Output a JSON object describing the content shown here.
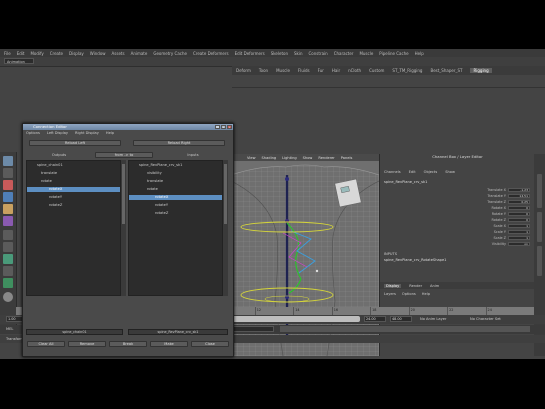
{
  "menubar": [
    "File",
    "Edit",
    "Modify",
    "Create",
    "Display",
    "Window",
    "Assets",
    "Animate",
    "Geometry Cache",
    "Create Deformers",
    "Edit Deformers",
    "Skeleton",
    "Skin",
    "Constrain",
    "Character",
    "Muscle",
    "Pipeline Cache",
    "Help"
  ],
  "mode": "Animation",
  "shelf_tabs": [
    {
      "label": "Deform",
      "active": false
    },
    {
      "label": "Toon",
      "active": false
    },
    {
      "label": "Muscle",
      "active": false
    },
    {
      "label": "Fluids",
      "active": false
    },
    {
      "label": "Fur",
      "active": false
    },
    {
      "label": "Hair",
      "active": false
    },
    {
      "label": "nCloth",
      "active": false
    },
    {
      "label": "Custom",
      "active": false
    },
    {
      "label": "ST_TM_Rigging",
      "active": false
    },
    {
      "label": "Best_Shaper_ST",
      "active": false
    },
    {
      "label": "Rigging",
      "active": true
    }
  ],
  "connection_editor": {
    "title": "Connection Editor",
    "menu": [
      "Options",
      "Left Display",
      "Right Display",
      "Help"
    ],
    "reload_left": "Reload Left",
    "reload_right": "Reload Right",
    "outputs_label": "Outputs",
    "from_to_label": "from -> to",
    "inputs_label": "Inputs",
    "left_items": [
      {
        "label": "spine_chain01",
        "indent": 10,
        "sel": false
      },
      {
        "label": "translate",
        "indent": 14,
        "sel": false
      },
      {
        "label": "rotate",
        "indent": 14,
        "sel": false
      },
      {
        "label": "rotateX",
        "indent": 22,
        "sel": true
      },
      {
        "label": "rotateY",
        "indent": 22,
        "sel": false
      },
      {
        "label": "rotateZ",
        "indent": 22,
        "sel": false
      }
    ],
    "right_items": [
      {
        "label": "spine_RevPlane_crv_sk1",
        "indent": 10,
        "sel": false
      },
      {
        "label": "visibility",
        "indent": 18,
        "sel": false
      },
      {
        "label": "translate",
        "indent": 18,
        "sel": false
      },
      {
        "label": "rotate",
        "indent": 18,
        "sel": false
      },
      {
        "label": "rotateX",
        "indent": 26,
        "sel": true
      },
      {
        "label": "rotateY",
        "indent": 26,
        "sel": false
      },
      {
        "label": "rotateZ",
        "indent": 26,
        "sel": false
      }
    ],
    "left_object": "spine_chain01",
    "right_object": "spine_RevPlane_crv_sk1",
    "buttons": [
      "Clear All",
      "Remove",
      "Break",
      "Make",
      "Close"
    ]
  },
  "viewport": {
    "menu": [
      "View",
      "Shading",
      "Lighting",
      "Show",
      "Renderer",
      "Panels"
    ]
  },
  "channel_box": {
    "title": "Channel Box / Layer Editor",
    "menu": [
      "Channels",
      "Edit",
      "Objects",
      "Show"
    ],
    "node": "spine_RevPlane_crv_sk1",
    "attributes": [
      {
        "label": "Translate X",
        "value": "-1.23"
      },
      {
        "label": "Translate Y",
        "value": "14.51"
      },
      {
        "label": "Translate Z",
        "value": "0.25"
      },
      {
        "label": "Rotate X",
        "value": "0"
      },
      {
        "label": "Rotate Y",
        "value": "0"
      },
      {
        "label": "Rotate Z",
        "value": "0"
      },
      {
        "label": "Scale X",
        "value": "1"
      },
      {
        "label": "Scale Y",
        "value": "1"
      },
      {
        "label": "Scale Z",
        "value": "1"
      },
      {
        "label": "Visibility",
        "value": "on"
      }
    ],
    "inputs_header": "INPUTS",
    "input_node": "spine_RevPlane_crv_RotateShape1",
    "layer_tabs": [
      {
        "label": "Display",
        "active": true
      },
      {
        "label": "Render",
        "active": false
      },
      {
        "label": "Anim",
        "active": false
      }
    ],
    "layer_menu": [
      "Layers",
      "Options",
      "Help"
    ],
    "layer": {
      "vis": "V",
      "name": "character_layer"
    }
  },
  "timeslider": {
    "ticks": [
      "2",
      "4",
      "6",
      "8",
      "10",
      "12",
      "14",
      "16",
      "18",
      "20",
      "22",
      "24"
    ],
    "start": "1.00",
    "current": "1.00",
    "end": "24.00",
    "range_end": "48.00",
    "anim_layer": "No Anim Layer",
    "char_set": "No Character Set"
  },
  "cmd_label": "MEL",
  "help_text": "Transform Tool"
}
